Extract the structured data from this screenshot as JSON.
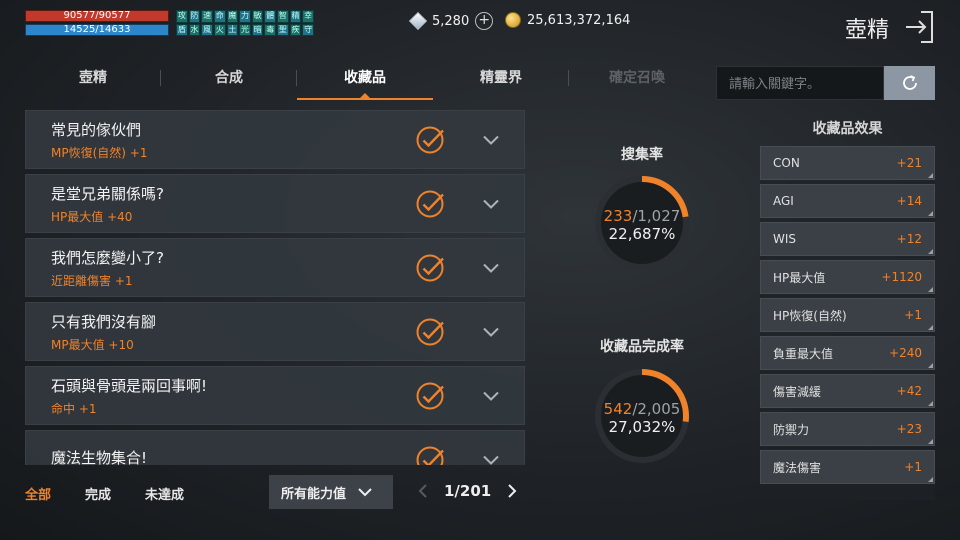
{
  "status": {
    "hp": "90577/90577",
    "mp": "14525/14633",
    "buffs": [
      "攻",
      "防",
      "速",
      "命",
      "魔",
      "力",
      "敏",
      "體",
      "智",
      "精",
      "幸",
      "盾",
      "水",
      "風",
      "火",
      "土",
      "光",
      "暗",
      "毒",
      "聖",
      "疾",
      "守"
    ]
  },
  "currency": {
    "gems": "5,280",
    "gold": "25,613,372,164"
  },
  "header": {
    "title": "壺精"
  },
  "tabs": [
    {
      "label": "壺精"
    },
    {
      "label": "合成"
    },
    {
      "label": "收藏品"
    },
    {
      "label": "精靈界"
    },
    {
      "label": "確定召喚"
    }
  ],
  "search": {
    "placeholder": "請輸入關鍵字。"
  },
  "collection": [
    {
      "title": "常見的傢伙們",
      "effect": "MP恢復(自然)  +1"
    },
    {
      "title": "是堂兄弟關係嗎?",
      "effect": "HP最大值  +40"
    },
    {
      "title": "我們怎麼變小了?",
      "effect": "近距離傷害  +1"
    },
    {
      "title": "只有我們沒有腳",
      "effect": "MP最大值  +10"
    },
    {
      "title": "石頭與骨頭是兩回事啊!",
      "effect": "命中  +1"
    },
    {
      "title": "魔法生物集合!",
      "effect": ""
    }
  ],
  "filters": {
    "all": "全部",
    "done": "完成",
    "undone": "未達成",
    "select": "所有能力值"
  },
  "pager": {
    "text": "1/201"
  },
  "stats": {
    "collect_rate": {
      "label": "搜集率",
      "current": "233",
      "total": "/1,027",
      "percent": "22,687%",
      "fraction": 0.227
    },
    "complete_rate": {
      "label": "收藏品完成率",
      "current": "542",
      "total": "/2,005",
      "percent": "27,032%",
      "fraction": 0.27
    }
  },
  "effects": {
    "title": "收藏品效果",
    "rows": [
      {
        "name": "CON",
        "value": "+21"
      },
      {
        "name": "AGI",
        "value": "+14"
      },
      {
        "name": "WIS",
        "value": "+12"
      },
      {
        "name": "HP最大值",
        "value": "+1120"
      },
      {
        "name": "HP恢復(自然)",
        "value": "+1"
      },
      {
        "name": "負重最大值",
        "value": "+240"
      },
      {
        "name": "傷害減緩",
        "value": "+42"
      },
      {
        "name": "防禦力",
        "value": "+23"
      },
      {
        "name": "魔法傷害",
        "value": "+1"
      }
    ]
  },
  "colors": {
    "accent": "#f0822a",
    "hp": "#c0392b",
    "mp": "#2c86c9"
  }
}
